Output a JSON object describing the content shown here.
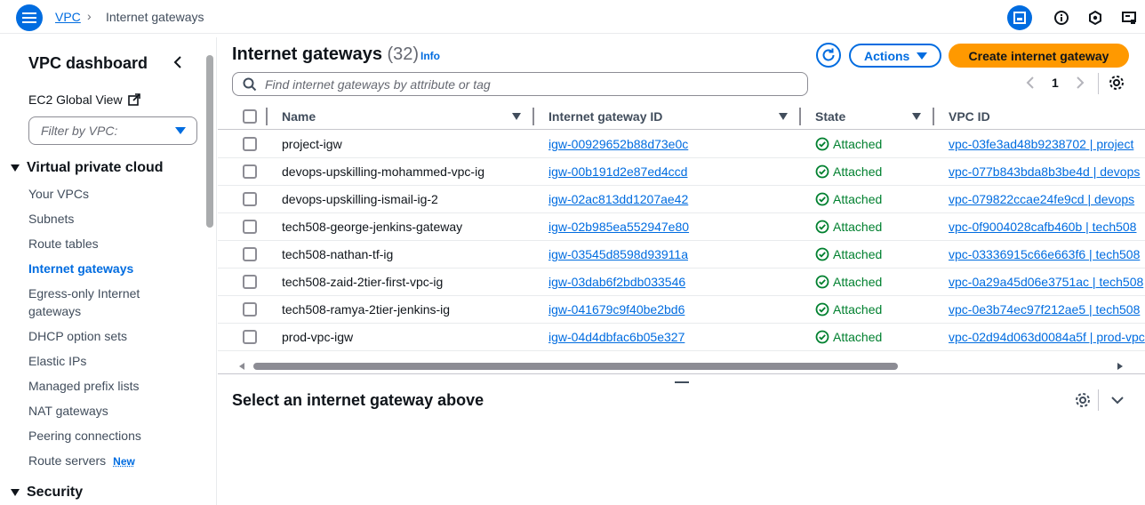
{
  "breadcrumb": {
    "root": "VPC",
    "separator": "›",
    "current": "Internet gateways"
  },
  "sidebar": {
    "title": "VPC dashboard",
    "ec2_global_view": "EC2 Global View",
    "filter_placeholder": "Filter by VPC:",
    "section_vpc": "Virtual private cloud",
    "items": [
      "Your VPCs",
      "Subnets",
      "Route tables",
      "Internet gateways",
      "Egress-only Internet gateways",
      "DHCP option sets",
      "Elastic IPs",
      "Managed prefix lists",
      "NAT gateways",
      "Peering connections",
      "Route servers"
    ],
    "new_badge": "New",
    "section_security": "Security"
  },
  "page": {
    "title": "Internet gateways",
    "count": "(32)",
    "info": "Info",
    "actions_label": "Actions",
    "create_label": "Create internet gateway",
    "search_placeholder": "Find internet gateways by attribute or tag",
    "page_number": "1"
  },
  "table": {
    "columns": [
      "Name",
      "Internet gateway ID",
      "State",
      "VPC ID"
    ],
    "rows": [
      {
        "name": "project-igw",
        "id": "igw-00929652b88d73e0c",
        "state": "Attached",
        "vpc": "vpc-03fe3ad48b9238702 | project"
      },
      {
        "name": "devops-upskilling-mohammed-vpc-ig",
        "id": "igw-00b191d2e87ed4ccd",
        "state": "Attached",
        "vpc": "vpc-077b843bda8b3be4d | devops"
      },
      {
        "name": "devops-upskilling-ismail-ig-2",
        "id": "igw-02ac813dd1207ae42",
        "state": "Attached",
        "vpc": "vpc-079822ccae24fe9cd | devops"
      },
      {
        "name": "tech508-george-jenkins-gateway",
        "id": "igw-02b985ea552947e80",
        "state": "Attached",
        "vpc": "vpc-0f9004028cafb460b | tech508"
      },
      {
        "name": "tech508-nathan-tf-ig",
        "id": "igw-03545d8598d93911a",
        "state": "Attached",
        "vpc": "vpc-03336915c66e663f6 | tech508"
      },
      {
        "name": "tech508-zaid-2tier-first-vpc-ig",
        "id": "igw-03dab6f2bdb033546",
        "state": "Attached",
        "vpc": "vpc-0a29a45d06e3751ac | tech508"
      },
      {
        "name": "tech508-ramya-2tier-jenkins-ig",
        "id": "igw-041679c9f40be2bd6",
        "state": "Attached",
        "vpc": "vpc-0e3b74ec97f212ae5 | tech508"
      },
      {
        "name": "prod-vpc-igw",
        "id": "igw-04d4dbfac6b05e327",
        "state": "Attached",
        "vpc": "vpc-02d94d063d0084a5f | prod-vpc"
      }
    ]
  },
  "split_panel": {
    "title": "Select an internet gateway above"
  },
  "colors": {
    "primary": "#006ce0",
    "create": "#ff9900",
    "success": "#00802f"
  }
}
